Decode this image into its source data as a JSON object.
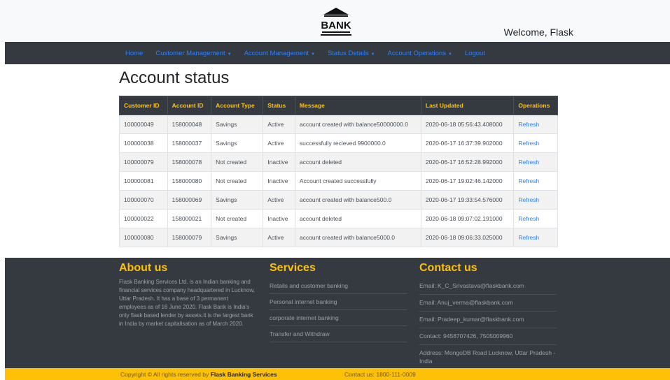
{
  "header": {
    "logo_text": "BANK",
    "welcome": "Welcome, Flask"
  },
  "nav": {
    "items": [
      {
        "label": "Home",
        "dropdown": false
      },
      {
        "label": "Customer Management",
        "dropdown": true
      },
      {
        "label": "Account Management",
        "dropdown": true
      },
      {
        "label": "Status Details",
        "dropdown": true
      },
      {
        "label": "Account Operations",
        "dropdown": true
      },
      {
        "label": "Logout",
        "dropdown": false
      }
    ]
  },
  "page": {
    "title": "Account status"
  },
  "table": {
    "headers": [
      "Customer ID",
      "Account ID",
      "Account Type",
      "Status",
      "Message",
      "Last Updated",
      "Operations"
    ],
    "rows": [
      {
        "customer_id": "100000049",
        "account_id": "158000048",
        "account_type": "Savings",
        "status": "Active",
        "message": "account created with balance50000000.0",
        "last_updated": "2020-06-18 05:56:43.408000",
        "operation": "Refresh"
      },
      {
        "customer_id": "100000038",
        "account_id": "158000037",
        "account_type": "Savings",
        "status": "Active",
        "message": "successfully recieved 9900000.0",
        "last_updated": "2020-06-17 16:37:39.902000",
        "operation": "Refresh"
      },
      {
        "customer_id": "100000079",
        "account_id": "158000078",
        "account_type": "Not created",
        "status": "Inactive",
        "message": "account deleted",
        "last_updated": "2020-06-17 16:52:28.992000",
        "operation": "Refresh"
      },
      {
        "customer_id": "100000081",
        "account_id": "158000080",
        "account_type": "Not created",
        "status": "Inactive",
        "message": "Account created successfully",
        "last_updated": "2020-06-17 19:02:46.142000",
        "operation": "Refresh"
      },
      {
        "customer_id": "100000070",
        "account_id": "158000069",
        "account_type": "Savings",
        "status": "Active",
        "message": "account created with balance500.0",
        "last_updated": "2020-06-17 19:33:54.576000",
        "operation": "Refresh"
      },
      {
        "customer_id": "100000022",
        "account_id": "158000021",
        "account_type": "Not created",
        "status": "Inactive",
        "message": "account deleted",
        "last_updated": "2020-06-18 09:07:02.191000",
        "operation": "Refresh"
      },
      {
        "customer_id": "100000080",
        "account_id": "158000079",
        "account_type": "Savings",
        "status": "Active",
        "message": "account created with balance5000.0",
        "last_updated": "2020-06-18 09:06:33.025000",
        "operation": "Refresh"
      }
    ]
  },
  "footer": {
    "about": {
      "title": "About us",
      "text": "Flask Banking Services Ltd. is an Indian banking and financial services company headquartered in Lucknow, Uttar Pradesh. It has a base of 3 permanent employees as of 16 June 2020. Flask Bank is India's only flask based lender by assets.It is the largest bank in India by market capitalisation as of March 2020."
    },
    "services": {
      "title": "Services",
      "items": [
        "Retails and customer banking",
        "Personal internet banking",
        "corporate internet banking",
        "Transfer and Withdraw"
      ]
    },
    "contact": {
      "title": "Contact us",
      "items": [
        "Email: K_C_Srivastava@flaskbank.com",
        "Email: Anuj_verma@flaskbank.com",
        "Email: Pradeep_kumar@flaskbank.com",
        "Contact: 9458707426, 7505009960",
        "Address: MongoDB Road Lucknow, Uttar Pradesh - India"
      ]
    }
  },
  "bottom": {
    "copyright_prefix": "Copyright © All rights reserved by ",
    "copyright_brand": "Flask Banking Services",
    "contact": "Contact us: 1800-111-0009"
  },
  "colors": {
    "nav_bg": "#343a40",
    "accent_yellow": "#ffc107",
    "link_blue": "#2d80ff"
  }
}
